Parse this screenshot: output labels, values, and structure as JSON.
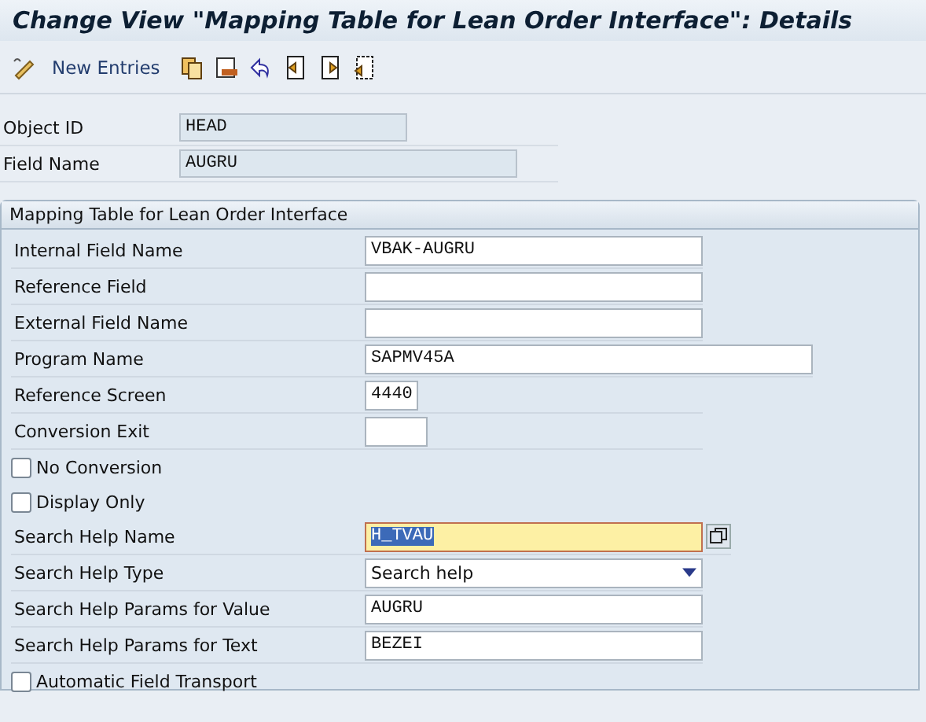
{
  "window": {
    "title": "Change View \"Mapping Table for Lean Order Interface\": Details"
  },
  "toolbar": {
    "new_entries": "New Entries"
  },
  "header_fields": [
    {
      "label": "Object ID",
      "value": "HEAD"
    },
    {
      "label": "Field Name",
      "value": "AUGRU"
    }
  ],
  "group": {
    "title": "Mapping Table for Lean Order Interface",
    "rows": [
      {
        "kind": "field",
        "label": "Internal Field Name",
        "value": "VBAK-AUGRU"
      },
      {
        "kind": "field",
        "label": "Reference Field"
      },
      {
        "kind": "field",
        "label": "External Field Name"
      },
      {
        "kind": "field",
        "label": "Program Name",
        "value": "SAPMV45A"
      },
      {
        "kind": "field",
        "label": "Reference Screen",
        "value": "4440"
      },
      {
        "kind": "field",
        "label": "Conversion Exit"
      },
      {
        "kind": "checkbox",
        "label": "No Conversion",
        "checked": false
      },
      {
        "kind": "checkbox",
        "label": "Display Only",
        "checked": false
      },
      {
        "kind": "field",
        "label": "Search Help Name",
        "value": "H_TVAU",
        "focused": true
      },
      {
        "kind": "dropdown",
        "label": "Search Help Type",
        "value": "Search help"
      },
      {
        "kind": "field",
        "label": "Search Help Params for Value",
        "value": "AUGRU"
      },
      {
        "kind": "field",
        "label": "Search Help Params for Text",
        "value": "BEZEI"
      },
      {
        "kind": "checkbox",
        "label": "Automatic Field Transport",
        "checked": false
      }
    ]
  }
}
